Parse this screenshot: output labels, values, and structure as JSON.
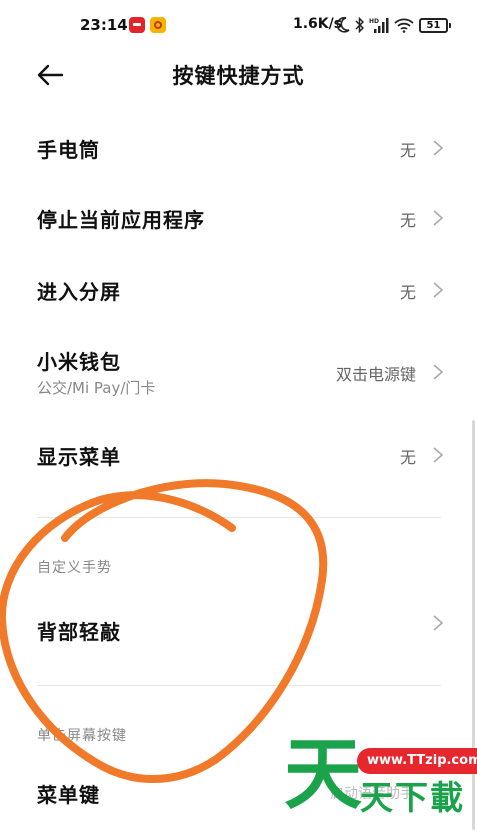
{
  "status_bar": {
    "time": "23:14",
    "network_speed": "1.6K/s",
    "battery": "51",
    "hd_label": "HD"
  },
  "header": {
    "title": "按键快捷方式"
  },
  "items": [
    {
      "title": "手电筒",
      "value": "无"
    },
    {
      "title": "停止当前应用程序",
      "value": "无"
    },
    {
      "title": "进入分屏",
      "value": "无"
    },
    {
      "title": "小米钱包",
      "subtitle": "公交/Mi Pay/门卡",
      "value": "双击电源键"
    },
    {
      "title": "显示菜单",
      "value": "无"
    }
  ],
  "sections": {
    "custom_gesture": {
      "label": "自定义手势",
      "items": [
        {
          "title": "背部轻敲"
        }
      ]
    },
    "screen_buttons": {
      "label": "单击屏幕按键",
      "items": [
        {
          "title": "菜单键",
          "value_partial": "启动语音助手"
        }
      ]
    }
  },
  "annotation": {
    "color": "#f07a2a"
  },
  "watermark": {
    "char": "天",
    "url": "www.TTzip.com",
    "text": "天下載"
  },
  "colors": {
    "primary_text": "#111111",
    "secondary_text": "#888888",
    "watermark_green": "#1aa34a",
    "watermark_red": "#e6282e"
  }
}
